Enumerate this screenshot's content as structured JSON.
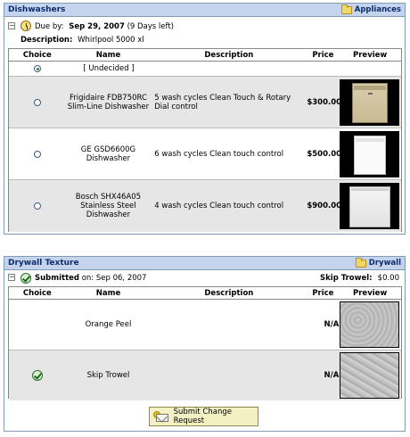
{
  "dishwashers": {
    "title": "Dishwashers",
    "category_link": "Appliances",
    "due_label": "Due by:",
    "due_date": "Sep 29, 2007",
    "days_left": "(9 Days left)",
    "description_label": "Description:",
    "description": "Whirlpool 5000 xl",
    "columns": [
      "Choice",
      "Name",
      "Description",
      "Price",
      "Preview"
    ],
    "undecided_label": "[ Undecided ]",
    "rows": [
      {
        "name": "Frigidaire FDB750RC Slim-Line Dishwasher",
        "description": "5 wash cycles Clean Touch & Rotary Dial control",
        "price": "$300.00",
        "preview": "bisque-dishwasher"
      },
      {
        "name": "GE GSD6600G Dishwasher",
        "description": "6 wash cycles Clean touch control",
        "price": "$500.00",
        "preview": "white-dishwasher"
      },
      {
        "name": "Bosch SHX46A05 Stainless Steel Dishwasher",
        "description": "4 wash cycles Clean touch control",
        "price": "$900.00",
        "preview": "white-dishwasher"
      }
    ]
  },
  "drywall": {
    "title": "Drywall Texture",
    "category_link": "Drywall",
    "status_label": "Submitted",
    "status_on": "on: Sep 06, 2007",
    "selected_label": "Skip Trowel:",
    "selected_price": "$0.00",
    "columns": [
      "Choice",
      "Name",
      "Description",
      "Price",
      "Preview"
    ],
    "rows": [
      {
        "name": "Orange Peel",
        "description": "",
        "price": "N/A",
        "preview": "texture"
      },
      {
        "name": "Skip Trowel",
        "description": "",
        "price": "N/A",
        "preview": "texture",
        "chosen": true
      }
    ]
  },
  "submit_button": "Submit Change Request"
}
